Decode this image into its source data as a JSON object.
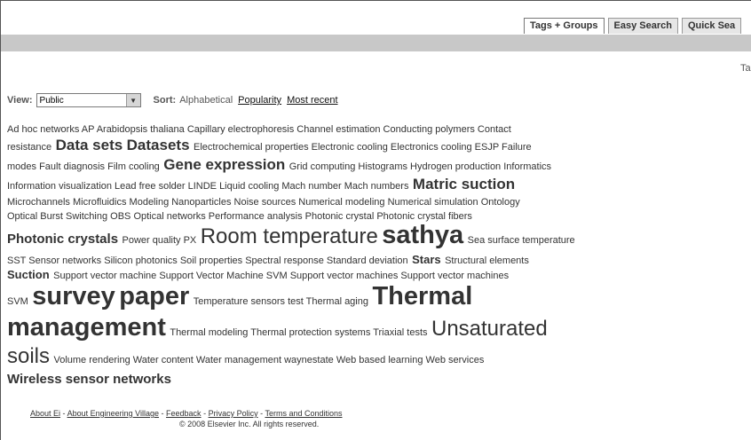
{
  "tabs": {
    "tags_groups": "Tags + Groups",
    "easy_search": "Easy Search",
    "quick_search": "Quick Sea"
  },
  "corner_text": "Ta",
  "view": {
    "label": "View:",
    "selected": "Public"
  },
  "sort": {
    "label": "Sort:",
    "current": "Alphabetical",
    "popularity": "Popularity",
    "most_recent": "Most recent"
  },
  "tags": {
    "line1": "Ad hoc networks AP Arabidopsis thaliana Capillary electrophoresis Channel estimation Conducting polymers Contact",
    "line2_a": "resistance",
    "line2_b": "Data sets",
    "line2_c": "Datasets",
    "line2_d": "Electrochemical properties Electronic cooling Electronics cooling ESJP Failure",
    "line3_a": "modes Fault diagnosis Film cooling",
    "line3_b": "Gene expression",
    "line3_c": "Grid computing Histograms Hydrogen production Informatics",
    "line4_a": "Information visualization Lead free solder LINDE Liquid cooling Mach number Mach numbers",
    "line4_b": "Matric suction",
    "line5": "Microchannels Microfluidics Modeling Nanoparticles Noise sources Numerical modeling Numerical simulation Ontology",
    "line6": "Optical Burst Switching OBS Optical networks Performance analysis Photonic crystal Photonic crystal fibers",
    "line7_a": "Photonic crystals",
    "line7_b": "Power quality PX",
    "line7_c": "Room temperature",
    "line7_d": "sathya",
    "line7_e": "Sea surface temperature",
    "line8_a": "SST Sensor networks Silicon photonics Soil properties Spectral response Standard deviation",
    "line8_b": "Stars",
    "line8_c": "Structural elements",
    "line9_a": "Suction",
    "line9_b": "Support vector machine Support Vector Machine SVM Support vector machines Support vector machines",
    "line10_a": "SVM",
    "line10_b": "survey",
    "line10_c": "paper",
    "line10_d": "Temperature sensors test Thermal aging",
    "line10_e": "Thermal",
    "line11_a": "management",
    "line11_b": "Thermal modeling Thermal protection systems Triaxial tests",
    "line11_c": "Unsaturated",
    "line12_a": "soils",
    "line12_b": "Volume rendering Water content Water management waynestate Web based learning Web services",
    "line13": "Wireless sensor networks"
  },
  "footer": {
    "about_ei": "About Ei",
    "about_ev": "About Engineering Village",
    "feedback": "Feedback",
    "privacy": "Privacy Policy",
    "terms": "Terms and Conditions",
    "sep": "-",
    "copyright": "© 2008 Elsevier Inc. All rights reserved."
  }
}
